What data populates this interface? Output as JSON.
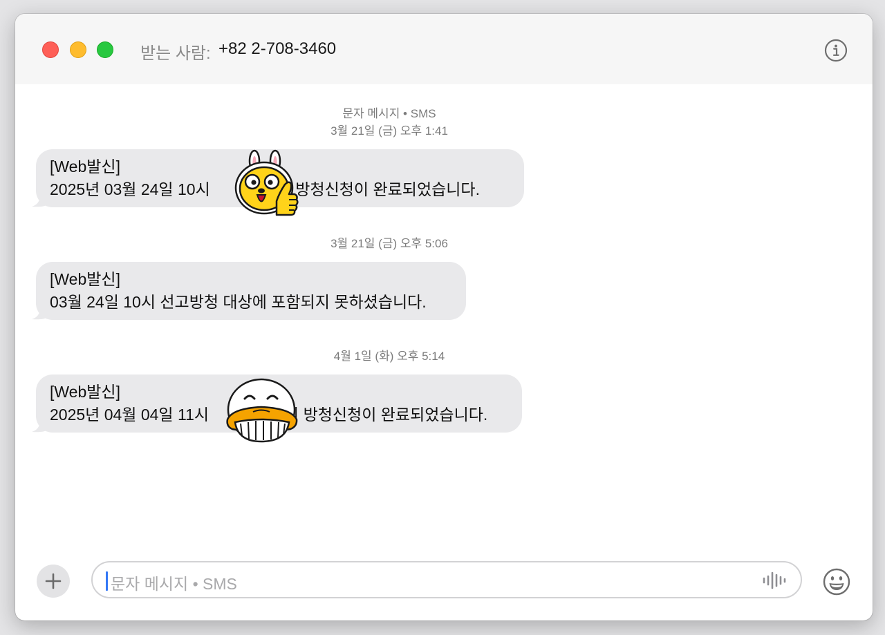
{
  "header": {
    "to_label": "받는 사람:",
    "to_value": "+82 2-708-3460"
  },
  "messages": [
    {
      "meta_service": "문자 메시지 • SMS",
      "meta_time": "3월 21일 (금) 오후 1:41",
      "line1": "[Web발신]",
      "line2_before": "2025년 03월 24일 10시",
      "line2_after": "의 방청신청이 완료되었습니다.",
      "sticker": "rabbit-thumbs-up-sticker"
    },
    {
      "meta_time": "3월 21일 (금) 오후 5:06",
      "line1": "[Web발신]",
      "line2": "03월 24일 10시 선고방청 대상에 포함되지 못하셨습니다."
    },
    {
      "meta_time": "4월 1일 (화) 오후 5:14",
      "line1": "[Web발신]",
      "line2_before": "2025년 04월 04일 11시",
      "line2_after": "의 방청신청이 완료되었습니다.",
      "sticker": "duck-grin-sticker"
    }
  ],
  "composer": {
    "placeholder": "문자 메시지 • SMS",
    "icons": [
      "plus-icon",
      "waveform-icon",
      "emoji-icon"
    ]
  },
  "colors": {
    "bubble": "#e9e9eb",
    "caret": "#3478f6",
    "sticker_yellow": "#ffd31a",
    "sticker_orange": "#f5a300"
  }
}
